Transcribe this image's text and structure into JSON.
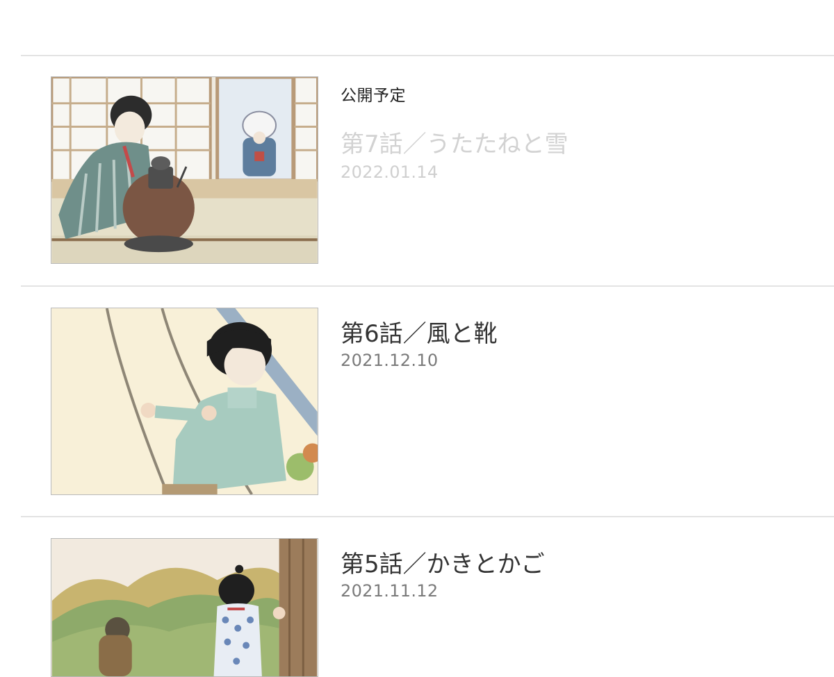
{
  "episodes": [
    {
      "status": "公開予定",
      "title": "第7話／うたたねと雪",
      "date": "2022.01.14",
      "thumbnail": "woman-by-hibachi-window-illustration"
    },
    {
      "status": "",
      "title": "第6話／風と靴",
      "date": "2021.12.10",
      "thumbnail": "girl-on-swing-illustration"
    },
    {
      "status": "",
      "title": "第5話／かきとかご",
      "date": "2021.11.12",
      "thumbnail": "child-mountain-autumn-illustration"
    }
  ],
  "colors": {
    "divider": "#e3e3e3",
    "upcoming_text": "#d2d2d2",
    "title_text": "#333333",
    "date_text": "#7a7a7a"
  }
}
